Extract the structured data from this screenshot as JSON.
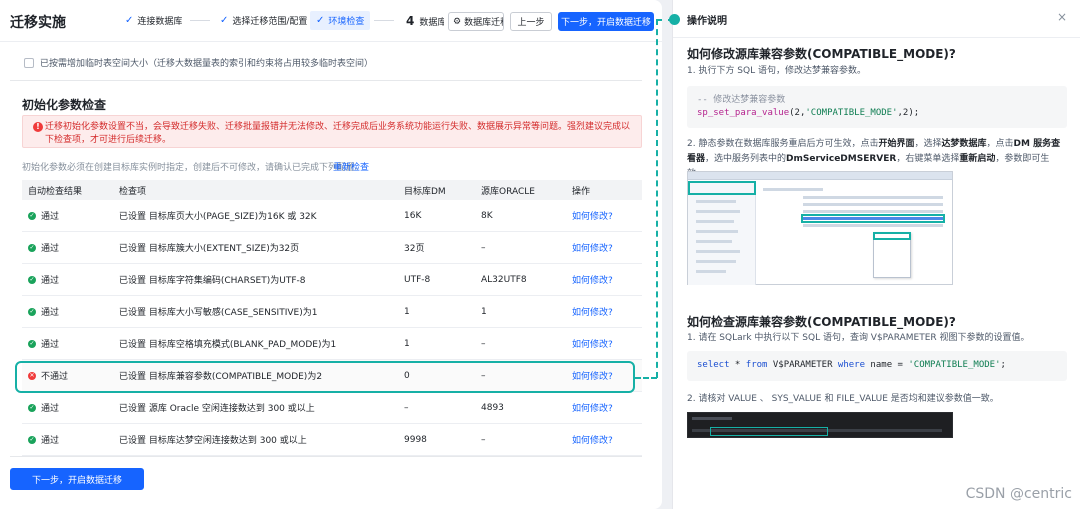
{
  "header": {
    "title": "迁移实施",
    "steps": [
      {
        "label": "连接数据库",
        "state": "done"
      },
      {
        "label": "选择迁移范围/配置",
        "state": "done"
      },
      {
        "label": "环境检查",
        "state": "active"
      },
      {
        "label": "数据库迁移配置",
        "number": "4",
        "state": "pending"
      }
    ],
    "prev_button": "上一步",
    "next_button": "下一步，开启数据迁移"
  },
  "temp_space": {
    "label": "已按需增加临时表空间大小（迁移大数据量表的索引和约束将占用较多临时表空间）"
  },
  "init_check": {
    "title": "初始化参数检查",
    "alert": "迁移初始化参数设置不当，会导致迁移失败、迁移批量报错并无法修改、迁移完成后业务系统功能运行失败、数据展示异常等问题。强烈建议完成以下检查项，才可进行后续迁移。",
    "hint": "初始化参数必须在创建目标库实例时指定，创建后不可修改，请确认已完成下列配置。",
    "recheck_link": "重新检查",
    "columns": [
      "自动检查结果",
      "检查项",
      "目标库DM",
      "源库ORACLE",
      "操作"
    ],
    "rows": [
      {
        "result": "通过",
        "status": "pass",
        "item": "已设置 目标库页大小(PAGE_SIZE)为16K 或 32K",
        "dm": "16K",
        "oracle": "8K",
        "action": "如何修改?"
      },
      {
        "result": "通过",
        "status": "pass",
        "item": "已设置 目标库簇大小(EXTENT_SIZE)为32页",
        "dm": "32页",
        "oracle": "–",
        "action": "如何修改?"
      },
      {
        "result": "通过",
        "status": "pass",
        "item": "已设置 目标库字符集编码(CHARSET)为UTF-8",
        "dm": "UTF-8",
        "oracle": "AL32UTF8",
        "action": "如何修改?"
      },
      {
        "result": "通过",
        "status": "pass",
        "item": "已设置 目标库大小写敏感(CASE_SENSITIVE)为1",
        "dm": "1",
        "oracle": "1",
        "action": "如何修改?"
      },
      {
        "result": "通过",
        "status": "pass",
        "item": "已设置 目标库空格填充模式(BLANK_PAD_MODE)为1",
        "dm": "1",
        "oracle": "–",
        "action": "如何修改?"
      },
      {
        "result": "不通过",
        "status": "fail",
        "item": "已设置 目标库兼容参数(COMPATIBLE_MODE)为2",
        "dm": "0",
        "oracle": "–",
        "action": "如何修改?"
      },
      {
        "result": "通过",
        "status": "pass",
        "item": "已设置 源库 Oracle 空闲连接数达到 300 或以上",
        "dm": "–",
        "oracle": "4893",
        "action": "如何修改?"
      },
      {
        "result": "通过",
        "status": "pass",
        "item": "已设置 目标库达梦空闲连接数达到 300 或以上",
        "dm": "9998",
        "oracle": "–",
        "action": "如何修改?"
      }
    ]
  },
  "footer": {
    "next_button": "下一步，开启数据迁移"
  },
  "help_panel": {
    "title": "操作说明",
    "close": "×",
    "section1_title": "如何修改源库兼容参数(COMPATIBLE_MODE)?",
    "section1_step1": "1. 执行下方 SQL 语句，修改达梦兼容参数。",
    "code1_comment": "-- 修改达梦兼容参数",
    "code1_fn": "sp_set_para_value",
    "code1_open": "(2,",
    "code1_str": "'COMPATIBLE_MODE'",
    "code1_close": ",2);",
    "section1_step2_pre": "2. 静态参数在数据库服务重启后方可生效，点击",
    "section1_step2_b1": "开始界面",
    "section1_step2_m1": "，选择",
    "section1_step2_b2": "达梦数据库",
    "section1_step2_m2": "，点击",
    "section1_step2_b3": "DM 服务查看器",
    "section1_step2_m3": "，选中服务列表中的",
    "section1_step2_b4": "DmServiceDMSERVER",
    "section1_step2_m4": "，右键菜单选择",
    "section1_step2_b5": "重新启动",
    "section1_step2_post": "，参数即可生效。",
    "section2_title": "如何检查源库兼容参数(COMPATIBLE_MODE)?",
    "section2_step1": "1. 请在 SQLark 中执行以下 SQL 语句，查询 V$PARAMETER 视图下参数的设置值。",
    "code2_kw1": "select",
    "code2_mid1": " * ",
    "code2_kw2": "from",
    "code2_mid2": " V$PARAMETER ",
    "code2_kw3": "where",
    "code2_mid3": " name = ",
    "code2_str": "'COMPATIBLE_MODE'",
    "code2_end": ";",
    "section2_step2": "2. 请核对 VALUE 、 SYS_VALUE 和 FILE_VALUE 是否均和建议参数值一致。"
  },
  "watermark": "CSDN @centric",
  "colors": {
    "primary": "#1664ff",
    "pass": "#1aa35b",
    "fail": "#f03a3a",
    "highlight": "#16b0a6"
  }
}
